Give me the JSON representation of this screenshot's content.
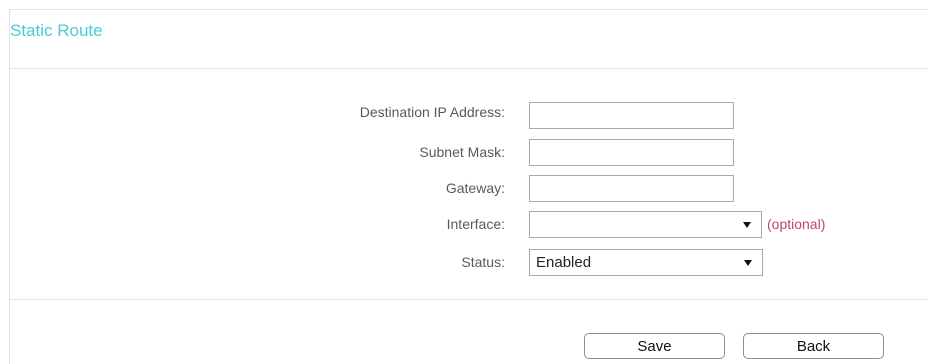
{
  "page": {
    "title": "Static Route"
  },
  "form": {
    "destination_ip": {
      "label": "Destination IP Address:",
      "value": ""
    },
    "subnet_mask": {
      "label": "Subnet Mask:",
      "value": ""
    },
    "gateway": {
      "label": "Gateway:",
      "value": ""
    },
    "interface": {
      "label": "Interface:",
      "value": "",
      "hint": "(optional)"
    },
    "status": {
      "label": "Status:",
      "value": "Enabled"
    }
  },
  "actions": {
    "save_label": "Save",
    "back_label": "Back"
  },
  "colors": {
    "title": "#4acbd6",
    "optional_hint": "#c0437a",
    "label": "#5a5a5a",
    "border": "#a9a9a9"
  }
}
